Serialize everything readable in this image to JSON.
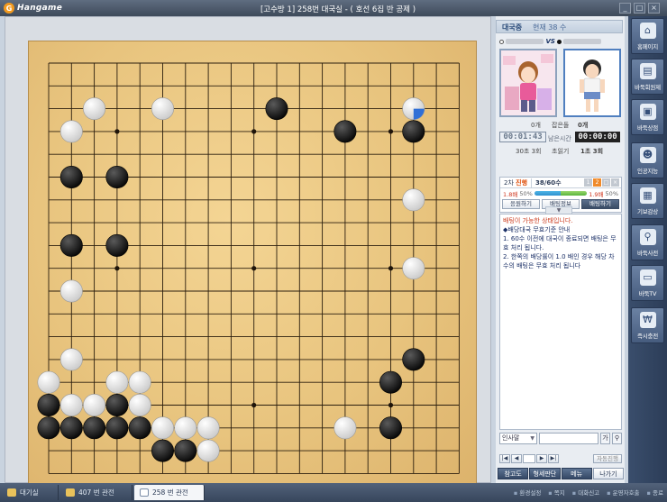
{
  "app": {
    "brand": "Hangame",
    "window_title": "[고수방 1] 258번 대국실  - ( 호선 6집 반 공제 )",
    "controls": [
      "_",
      "□",
      "×"
    ]
  },
  "board": {
    "stones": [
      {
        "color": "white",
        "col": 3,
        "row": 3
      },
      {
        "color": "white",
        "col": 6,
        "row": 3
      },
      {
        "color": "black",
        "col": 11,
        "row": 3
      },
      {
        "color": "white",
        "col": 17,
        "row": 3,
        "last_move": true
      },
      {
        "color": "white",
        "col": 2,
        "row": 4
      },
      {
        "color": "black",
        "col": 14,
        "row": 4
      },
      {
        "color": "black",
        "col": 17,
        "row": 4
      },
      {
        "color": "black",
        "col": 2,
        "row": 6
      },
      {
        "color": "black",
        "col": 4,
        "row": 6
      },
      {
        "color": "white",
        "col": 17,
        "row": 7
      },
      {
        "color": "black",
        "col": 2,
        "row": 9
      },
      {
        "color": "black",
        "col": 4,
        "row": 9
      },
      {
        "color": "white",
        "col": 17,
        "row": 10
      },
      {
        "color": "white",
        "col": 2,
        "row": 11
      },
      {
        "color": "white",
        "col": 2,
        "row": 14
      },
      {
        "color": "black",
        "col": 17,
        "row": 14
      },
      {
        "color": "white",
        "col": 1,
        "row": 15
      },
      {
        "color": "white",
        "col": 4,
        "row": 15
      },
      {
        "color": "white",
        "col": 5,
        "row": 15
      },
      {
        "color": "black",
        "col": 16,
        "row": 15
      },
      {
        "color": "black",
        "col": 1,
        "row": 16
      },
      {
        "color": "white",
        "col": 2,
        "row": 16
      },
      {
        "color": "white",
        "col": 3,
        "row": 16
      },
      {
        "color": "black",
        "col": 4,
        "row": 16
      },
      {
        "color": "white",
        "col": 5,
        "row": 16
      },
      {
        "color": "black",
        "col": 1,
        "row": 17
      },
      {
        "color": "black",
        "col": 2,
        "row": 17
      },
      {
        "color": "black",
        "col": 3,
        "row": 17
      },
      {
        "color": "black",
        "col": 4,
        "row": 17
      },
      {
        "color": "black",
        "col": 5,
        "row": 17
      },
      {
        "color": "white",
        "col": 6,
        "row": 17
      },
      {
        "color": "white",
        "col": 7,
        "row": 17
      },
      {
        "color": "white",
        "col": 8,
        "row": 17
      },
      {
        "color": "white",
        "col": 14,
        "row": 17
      },
      {
        "color": "black",
        "col": 16,
        "row": 17
      },
      {
        "color": "black",
        "col": 6,
        "row": 18
      },
      {
        "color": "black",
        "col": 7,
        "row": 18
      },
      {
        "color": "white",
        "col": 8,
        "row": 18
      }
    ]
  },
  "panel": {
    "status": {
      "state": "대국중",
      "move": "현재 38 수"
    },
    "players": {
      "vs": "VS"
    },
    "captures": {
      "left": "0개",
      "label": "잡은돌",
      "right": "0개"
    },
    "time": {
      "mine": "00:01:43",
      "label": "남은시간",
      "opp": "00:00:00"
    },
    "byoyomi": {
      "left": "30초 3회",
      "label": "초읽기",
      "right": "1초 3회"
    },
    "bet": {
      "round_label": "2차",
      "round_state": "진행",
      "moves": "38/60수",
      "left_rate": "1.8배",
      "left_pct": "50%",
      "right_rate": "1.9배",
      "right_pct": "50%",
      "fill_left": 0.5,
      "buttons": [
        "응원하기",
        "배팅정보",
        "배팅하기"
      ],
      "icons": [
        "1",
        "2",
        "□",
        "×"
      ]
    },
    "chat": {
      "handle": "▼",
      "lines": [
        {
          "text": "배팅이 가능한 상태입니다.",
          "red": true
        },
        {
          "text": "◆배당대국 무효기준 안내",
          "red": false
        },
        {
          "text": "1. 60수 이전에 대국이 종료되면 배팅은 무효 처리 됩니다.",
          "red": false
        },
        {
          "text": "2. 한쪽의 배당률이 1.0 배인 경우 해당 차수의 배팅은 무효 처리 됩니다",
          "red": false
        }
      ],
      "select_value": "인사말",
      "send_label": "가"
    },
    "nav": {
      "buttons": [
        "|◀",
        "◀",
        "▶",
        "▶|"
      ],
      "auto": "자동진행"
    },
    "actions": [
      "참고도",
      "형세판단",
      "메뉴",
      "나가기"
    ]
  },
  "sidebar": [
    {
      "label": "홈페이지",
      "icon": "⌂",
      "icon_name": "home-icon"
    },
    {
      "label": "바둑회원제",
      "icon": "▤",
      "icon_name": "membership-icon"
    },
    {
      "label": "바둑상점",
      "icon": "▣",
      "icon_name": "shop-icon"
    },
    {
      "label": "인공지능",
      "icon": "☻",
      "icon_name": "ai-icon"
    },
    {
      "label": "기보감상",
      "icon": "▦",
      "icon_name": "record-icon"
    },
    {
      "label": "바둑사전",
      "icon": "⚲",
      "icon_name": "dictionary-icon"
    },
    {
      "label": "바둑TV",
      "icon": "▭",
      "icon_name": "tv-icon"
    },
    {
      "label": "즉시충전",
      "icon": "₩",
      "icon_name": "charge-icon"
    }
  ],
  "bottom": {
    "tabs": [
      "대기실",
      "407 번 관전",
      "258 번 관전"
    ],
    "active_tab": 2,
    "links": [
      "환경설정",
      "쪽지",
      "대화신고",
      "운영자호출",
      "종료"
    ]
  }
}
